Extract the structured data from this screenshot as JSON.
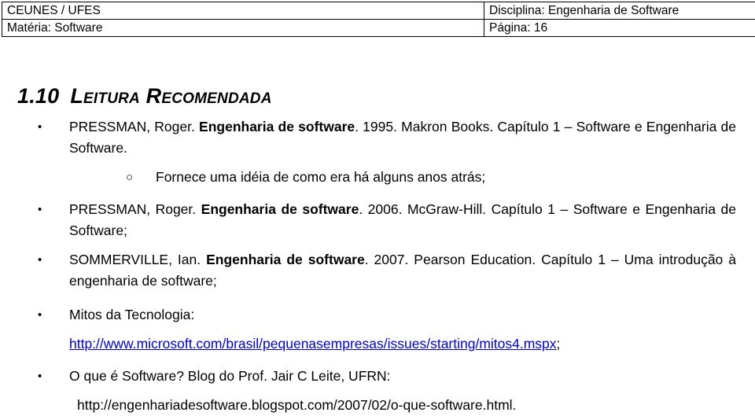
{
  "header": {
    "institution": "CEUNES / UFES",
    "discipline": "Disciplina: Engenharia de Software",
    "subject": "Matéria: Software",
    "page": "Página: 16"
  },
  "section": {
    "number": "1.10",
    "title": "Leitura Recomendada"
  },
  "items": {
    "pressman_1995_a": "PRESSMAN, Roger.  ",
    "pressman_1995_bold": "Engenharia de software",
    "pressman_1995_b": ". 1995. Makron Books. Capítulo 1 – Software e Engenharia de Software.",
    "sub_note": "Fornece uma idéia de como era há alguns anos atrás;",
    "pressman_2006_a": "PRESSMAN, Roger. ",
    "pressman_2006_bold": "Engenharia de software",
    "pressman_2006_b": ". 2006. McGraw-Hill. Capítulo 1 – Software e Engenharia de Software;",
    "sommerville_a": "SOMMERVILLE, Ian. ",
    "sommerville_bold": "Engenharia de software",
    "sommerville_b": ". 2007.  Pearson Education. Capítulo 1 – Uma introdução à engenharia de software;",
    "mitos_label": "Mitos da Tecnologia:",
    "mitos_url": "http://www.microsoft.com/brasil/pequenasempresas/issues/starting/mitos4.mspx",
    "mitos_url_suffix": ";",
    "blog_label": "O que é Software? Blog do Prof. Jair C Leite, UFRN:",
    "blog_url": "http://engenhariadesoftware.blogspot.com/2007/02/o-que-software.html."
  },
  "markers": {
    "bullet": "•",
    "sub_bullet": "○"
  },
  "colors": {
    "link": "#0000cc",
    "text": "#000000",
    "border": "#000000"
  }
}
